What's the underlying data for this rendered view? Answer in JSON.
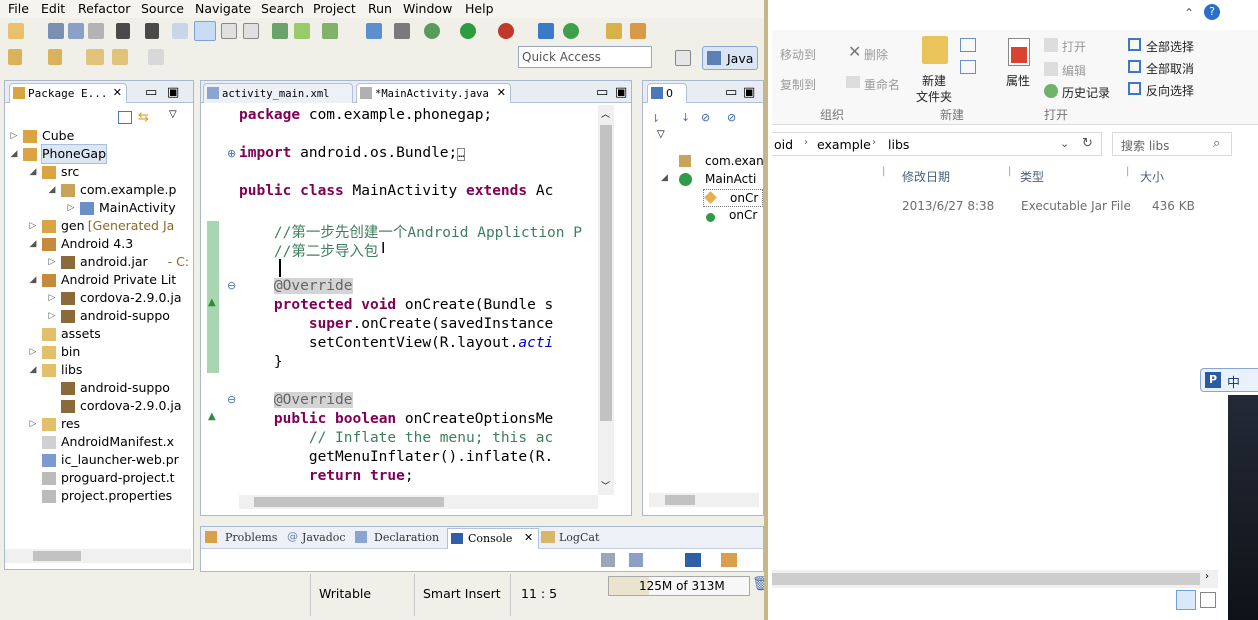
{
  "eclipse": {
    "menu": [
      "File",
      "Edit",
      "Refactor",
      "Source",
      "Navigate",
      "Search",
      "Project",
      "Run",
      "Window",
      "Help"
    ],
    "quick_access_placeholder": "Quick Access",
    "perspective": "Java",
    "package_explorer": {
      "tab_label": "Package E...",
      "tree": [
        {
          "label": "Cube",
          "indent": 0,
          "expanded": false,
          "icon": "project-icon"
        },
        {
          "label": "PhoneGap",
          "indent": 0,
          "expanded": true,
          "icon": "project-icon",
          "selected": true
        },
        {
          "label": "src",
          "indent": 1,
          "expanded": true,
          "icon": "source-folder-icon"
        },
        {
          "label": "com.example.p",
          "indent": 2,
          "expanded": true,
          "icon": "package-icon"
        },
        {
          "label": "MainActivity",
          "indent": 3,
          "expanded": false,
          "icon": "java-file-icon"
        },
        {
          "label": "gen",
          "suffix": "[Generated Ja",
          "indent": 1,
          "expanded": false,
          "icon": "source-folder-icon"
        },
        {
          "label": "Android 4.3",
          "indent": 1,
          "expanded": true,
          "icon": "library-icon"
        },
        {
          "label": "android.jar",
          "suffix": "- C:",
          "indent": 2,
          "expanded": false,
          "icon": "jar-icon"
        },
        {
          "label": "Android Private Lit",
          "indent": 1,
          "expanded": true,
          "icon": "library-icon"
        },
        {
          "label": "cordova-2.9.0.ja",
          "indent": 2,
          "expanded": false,
          "icon": "jar-icon"
        },
        {
          "label": "android-suppo",
          "indent": 2,
          "expanded": false,
          "icon": "jar-icon"
        },
        {
          "label": "assets",
          "indent": 1,
          "expanded": null,
          "icon": "folder-icon"
        },
        {
          "label": "bin",
          "indent": 1,
          "expanded": false,
          "icon": "folder-icon"
        },
        {
          "label": "libs",
          "indent": 1,
          "expanded": true,
          "icon": "folder-icon"
        },
        {
          "label": "android-suppo",
          "indent": 2,
          "expanded": null,
          "icon": "jar-icon"
        },
        {
          "label": "cordova-2.9.0.ja",
          "indent": 2,
          "expanded": null,
          "icon": "jar-icon"
        },
        {
          "label": "res",
          "indent": 1,
          "expanded": false,
          "icon": "folder-icon"
        },
        {
          "label": "AndroidManifest.x",
          "indent": 1,
          "expanded": null,
          "icon": "xml-file-icon"
        },
        {
          "label": "ic_launcher-web.pr",
          "indent": 1,
          "expanded": null,
          "icon": "image-file-icon"
        },
        {
          "label": "proguard-project.t",
          "indent": 1,
          "expanded": null,
          "icon": "text-file-icon"
        },
        {
          "label": "project.properties",
          "indent": 1,
          "expanded": null,
          "icon": "text-file-icon"
        }
      ]
    },
    "editor": {
      "tabs": [
        "activity_main.xml",
        "*MainActivity.java"
      ],
      "lines": [
        [
          {
            "t": "package",
            "c": "kw"
          },
          {
            "t": " com.example.phonegap;"
          }
        ],
        [],
        [
          {
            "t": "import",
            "c": "kw"
          },
          {
            "t": " android.os.Bundle;"
          },
          {
            "t": "…",
            "c": "box"
          }
        ],
        [],
        [
          {
            "t": "public",
            "c": "kw"
          },
          {
            "t": " "
          },
          {
            "t": "class",
            "c": "kw"
          },
          {
            "t": " MainActivity "
          },
          {
            "t": "extends",
            "c": "kw"
          },
          {
            "t": " Ac"
          }
        ],
        [],
        [
          {
            "t": "    //第一步先创建一个Android Appliction P",
            "c": "cm"
          }
        ],
        [
          {
            "t": "    //第二步导入包",
            "c": "cm"
          }
        ],
        [
          {
            "t": "    "
          }
        ],
        [
          {
            "t": "    "
          },
          {
            "t": "@Override",
            "c": "an"
          }
        ],
        [
          {
            "t": "    "
          },
          {
            "t": "protected",
            "c": "kw"
          },
          {
            "t": " "
          },
          {
            "t": "void",
            "c": "kw"
          },
          {
            "t": " onCreate(Bundle s"
          }
        ],
        [
          {
            "t": "        "
          },
          {
            "t": "super",
            "c": "kw"
          },
          {
            "t": ".onCreate(savedInstance"
          }
        ],
        [
          {
            "t": "        setContentView(R.layout."
          },
          {
            "t": "acti",
            "c": "it"
          }
        ],
        [
          {
            "t": "    }"
          }
        ],
        [],
        [
          {
            "t": "    "
          },
          {
            "t": "@Override",
            "c": "an"
          }
        ],
        [
          {
            "t": "    "
          },
          {
            "t": "public",
            "c": "kw"
          },
          {
            "t": " "
          },
          {
            "t": "boolean",
            "c": "kw"
          },
          {
            "t": " onCreateOptionsMe"
          }
        ],
        [
          {
            "t": "        // Inflate the menu; this ac",
            "c": "cm"
          }
        ],
        [
          {
            "t": "        getMenuInflater().inflate(R."
          }
        ],
        [
          {
            "t": "        "
          },
          {
            "t": "return",
            "c": "kw"
          },
          {
            "t": " "
          },
          {
            "t": "true",
            "c": "kw"
          },
          {
            "t": ";"
          }
        ]
      ]
    },
    "outline": {
      "tab_label": "0",
      "items": [
        "com.exan",
        "MainActi",
        "onCr",
        "onCr"
      ]
    },
    "bottom_tabs": [
      "Problems",
      "Javadoc",
      "Declaration",
      "Console",
      "LogCat"
    ],
    "status": {
      "writable": "Writable",
      "insert": "Smart Insert",
      "position": "11 : 5",
      "heap": "125M of 313M"
    }
  },
  "explorer": {
    "ribbon": {
      "move_to": "移动到",
      "delete": "删除",
      "copy_to": "复制到",
      "rename": "重命名",
      "new_folder_1": "新建",
      "new_folder_2": "文件夹",
      "properties": "属性",
      "open": "打开",
      "edit": "编辑",
      "history": "历史记录",
      "select_all": "全部选择",
      "select_none": "全部取消",
      "invert": "反向选择",
      "groups": [
        "组织",
        "新建",
        "打开"
      ]
    },
    "breadcrumb": [
      "oid",
      "example",
      "libs"
    ],
    "search_placeholder": "搜索 libs",
    "columns": [
      "修改日期",
      "类型",
      "大小"
    ],
    "file": {
      "date": "2013/6/27 8:38",
      "type": "Executable Jar File",
      "size": "436 KB"
    },
    "ime": "中"
  }
}
